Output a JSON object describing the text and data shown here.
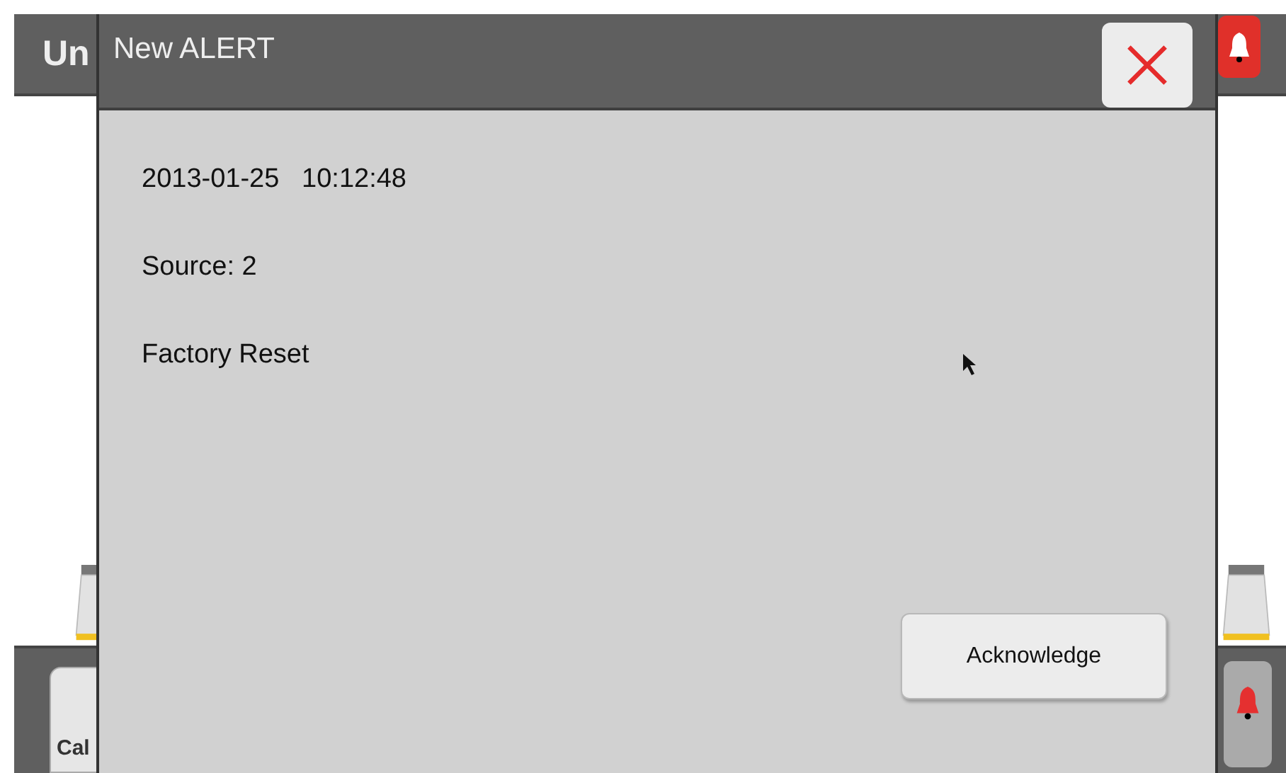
{
  "screen": {
    "title": "Un",
    "bottom_button": "Cal"
  },
  "dialog": {
    "title": "New ALERT",
    "lines": [
      "2013-01-25   10:12:48",
      "Source: 2",
      "Factory Reset"
    ],
    "button": "Acknowledge"
  }
}
